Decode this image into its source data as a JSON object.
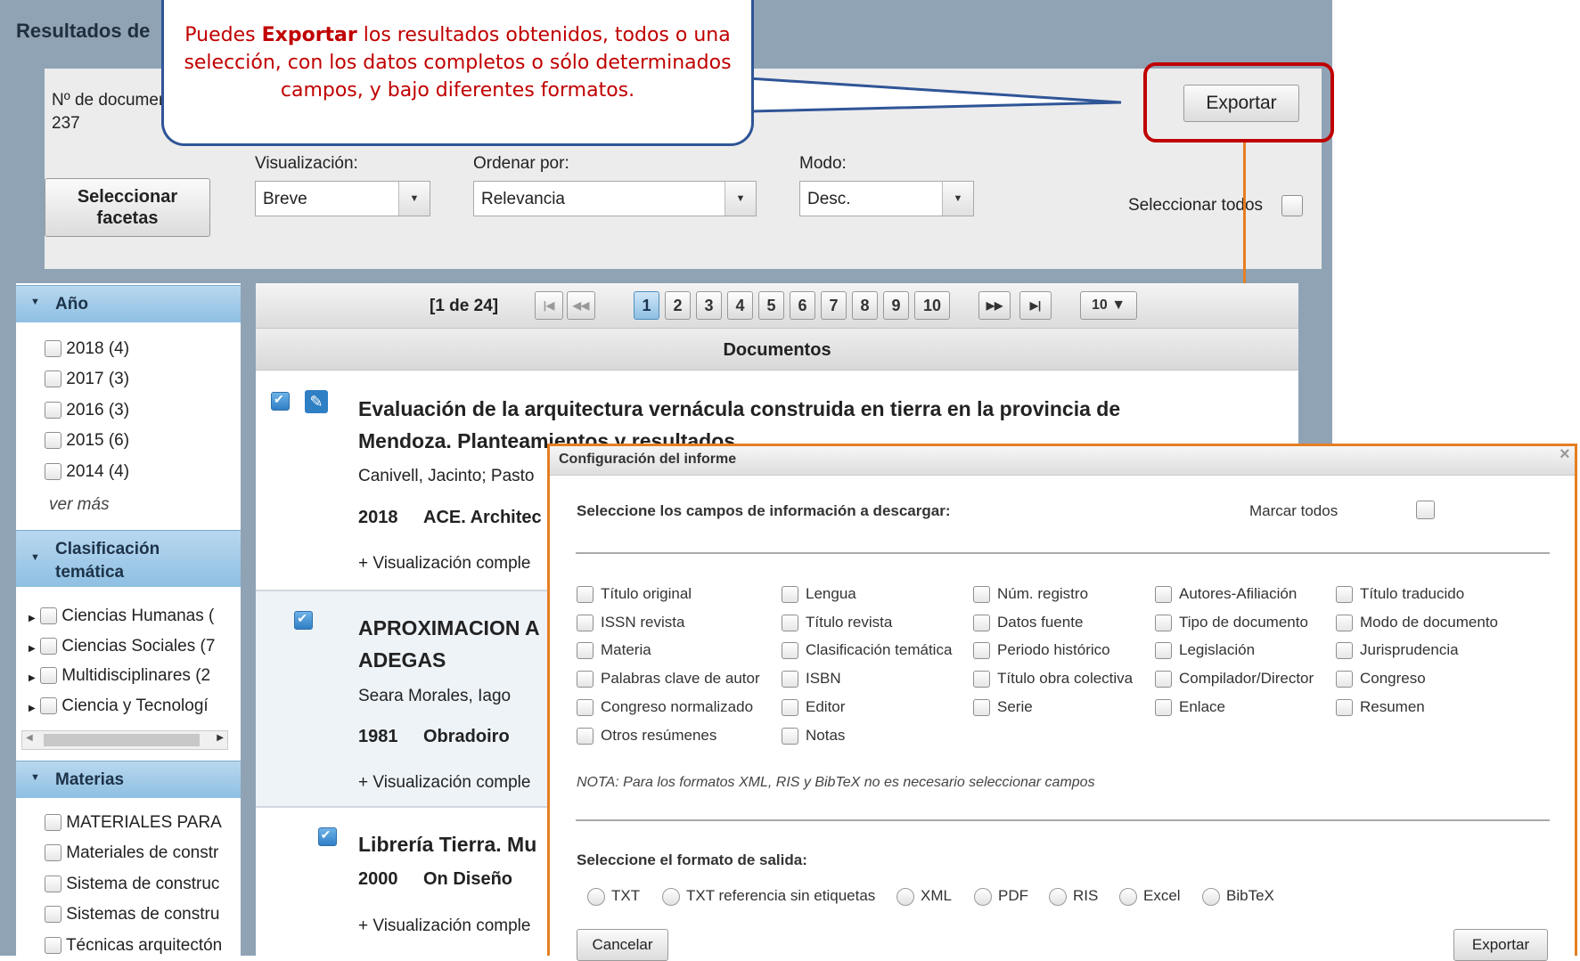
{
  "page": {
    "title": "Resultados de",
    "doc_count_label": "Nº de documer",
    "doc_count": "237"
  },
  "toolbar": {
    "export_label": "Exportar",
    "select_facets_label": "Seleccionar\nfacetas",
    "visualization_label": "Visualización:",
    "visualization_value": "Breve",
    "sort_label": "Ordenar por:",
    "sort_value": "Relevancia",
    "mode_label": "Modo:",
    "mode_value": "Desc.",
    "select_all_label": "Seleccionar todos"
  },
  "callout": {
    "text_before": "Puedes ",
    "text_bold": "Exportar",
    "text_after": " los resultados obtenidos, todos o una selección, con los datos completos o sólo determinados campos, y bajo diferentes formatos."
  },
  "facets": {
    "year": {
      "label": "Año",
      "items": [
        "2018 (4)",
        "2017 (3)",
        "2016 (3)",
        "2015 (6)",
        "2014 (4)"
      ],
      "more": "ver más"
    },
    "thematic": {
      "label": "Clasificación temática",
      "items": [
        "Ciencias Humanas (",
        "Ciencias Sociales (7",
        "Multidisciplinares (2",
        "Ciencia y Tecnologí"
      ]
    },
    "subjects": {
      "label": "Materias",
      "items": [
        "MATERIALES PARA",
        "Materiales de constr",
        "Sistema de construc",
        "Sistemas de constru",
        "Técnicas arquitectón"
      ]
    }
  },
  "pagination": {
    "summary": "[1 de 24]",
    "first": "|◀",
    "prev": "◀◀",
    "pages": [
      "1",
      "2",
      "3",
      "4",
      "5",
      "6",
      "7",
      "8",
      "9",
      "10"
    ],
    "current": "1",
    "next": "▶▶",
    "last": "▶|",
    "per_page": "10 ▼"
  },
  "results": {
    "header": "Documentos",
    "items": [
      {
        "title_line1": "Evaluación de la arquitectura vernácula construida en tierra en la provincia de",
        "title_line2": "Mendoza. Planteamientos y resultados",
        "authors": "Canivell, Jacinto; Pasto",
        "year": "2018",
        "source": "ACE. Architec",
        "more": "+ Visualización comple"
      },
      {
        "title_line1": "APROXIMACION A",
        "title_line2": "ADEGAS",
        "authors": "Seara Morales, Iago",
        "year": "1981",
        "source": "Obradoiro",
        "more": "+ Visualización comple"
      },
      {
        "title_line1": "Librería Tierra. Mu",
        "year": "2000",
        "source": "On Diseño",
        "more": "+ Visualización comple"
      }
    ]
  },
  "dialog": {
    "title": "Configuración del informe",
    "close": "×",
    "fields_prompt": "Seleccione los campos de información a descargar:",
    "mark_all": "Marcar todos",
    "fields": [
      "Título original",
      "Lengua",
      "Núm. registro",
      "Autores-Afiliación",
      "Título traducido",
      "ISSN revista",
      "Título revista",
      "Datos fuente",
      "Tipo de documento",
      "Modo de documento",
      "Materia",
      "Clasificación temática",
      "Periodo histórico",
      "Legislación",
      "Jurisprudencia",
      "Palabras clave de autor",
      "ISBN",
      "Título obra colectiva",
      "Compilador/Director",
      "Congreso",
      "Congreso normalizado",
      "Editor",
      "Serie",
      "Enlace",
      "Resumen",
      "Otros resúmenes",
      "Notas"
    ],
    "note": "NOTA: Para los formatos XML, RIS y BibTeX no es necesario seleccionar campos",
    "format_prompt": "Seleccione el formato de salida:",
    "formats": [
      "TXT",
      "TXT referencia sin etiquetas",
      "XML",
      "PDF",
      "RIS",
      "Excel",
      "BibTeX"
    ],
    "cancel": "Cancelar",
    "export": "Exportar"
  },
  "colors": {
    "frame": "#8fa3b5",
    "callout_border": "#2f5597",
    "callout_text": "#c00000",
    "highlight": "#c00000",
    "connector": "#e67e22",
    "facet_header": "#a9cdea"
  }
}
